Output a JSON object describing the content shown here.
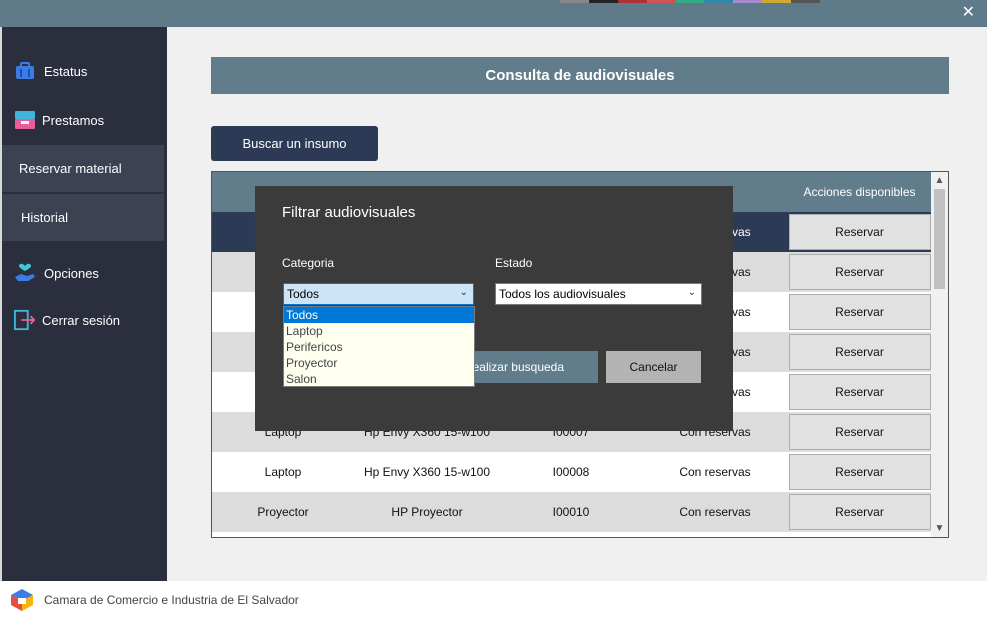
{
  "window": {
    "close_glyph": "✕"
  },
  "sidebar": {
    "items": [
      {
        "label": "Estatus",
        "icon": "briefcase-icon"
      },
      {
        "label": "Prestamos",
        "icon": "inbox-icon"
      },
      {
        "label": "Reservar material"
      },
      {
        "label": "Historial"
      },
      {
        "label": "Opciones",
        "icon": "hand-heart-icon"
      },
      {
        "label": "Cerrar sesión",
        "icon": "logout-icon"
      }
    ]
  },
  "main": {
    "title": "Consulta de audiovisuales",
    "search_button": "Buscar un insumo",
    "table": {
      "header_actions": "Acciones disponibles",
      "rows": [
        {
          "c4": "Con reservas",
          "action": "Reservar"
        },
        {
          "c4": "Con reservas",
          "action": "Reservar"
        },
        {
          "c4": "Con reservas",
          "action": "Reservar"
        },
        {
          "c4": "Con reservas",
          "action": "Reservar"
        },
        {
          "c4": "Con reservas",
          "action": "Reservar"
        },
        {
          "c1": "Laptop",
          "c2": "Hp Envy X360 15-w100",
          "c3": "I00007",
          "c4": "Con reservas",
          "action": "Reservar"
        },
        {
          "c1": "Laptop",
          "c2": "Hp Envy X360 15-w100",
          "c3": "I00008",
          "c4": "Con reservas",
          "action": "Reservar"
        },
        {
          "c1": "Proyector",
          "c2": "HP Proyector",
          "c3": "I00010",
          "c4": "Con reservas",
          "action": "Reservar"
        }
      ]
    }
  },
  "dialog": {
    "title": "Filtrar audiovisuales",
    "category_label": "Categoria",
    "category_value": "Todos",
    "state_label": "Estado",
    "state_value": "Todos los audiovisuales",
    "search_button": "Realizar busqueda",
    "cancel_button": "Cancelar",
    "category_options": [
      "Todos",
      "Laptop",
      "Perifericos",
      "Proyector",
      "Salon"
    ]
  },
  "footer": {
    "text": "Camara de Comercio e Industria de El Salvador"
  },
  "colors": {
    "accent": "#617d8b",
    "dark": "#2c3a56",
    "sidebar": "#2b2f3d",
    "dialog": "#3b3b3b"
  }
}
